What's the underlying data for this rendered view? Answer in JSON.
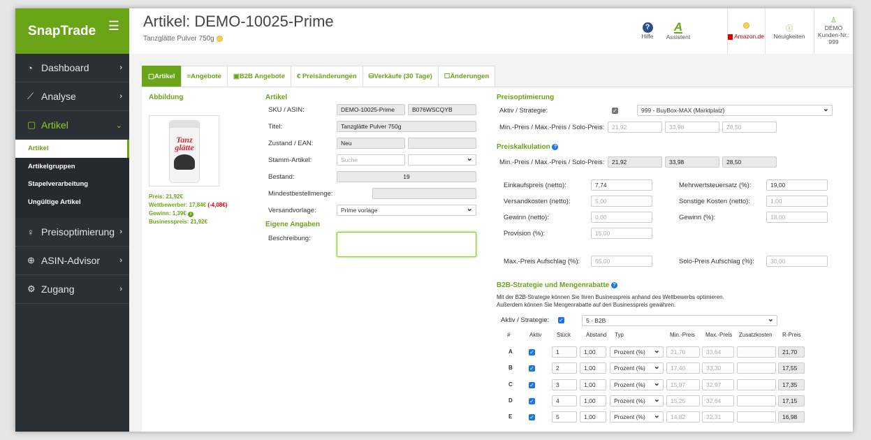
{
  "app": {
    "logo": "SnapTrade"
  },
  "sidebar": {
    "items": [
      {
        "label": "Dashboard",
        "icon": "dashboard-gauge-icon"
      },
      {
        "label": "Analyse",
        "icon": "chart-line-icon"
      },
      {
        "label": "Artikel",
        "icon": "bag-icon"
      },
      {
        "label": "Preisoptimierung",
        "icon": "lightbulb-icon"
      },
      {
        "label": "ASIN-Advisor",
        "icon": "magnifier-plus-icon"
      },
      {
        "label": "Zugang",
        "icon": "gear-icon"
      }
    ],
    "subitems": [
      "Artikel",
      "Artikelgruppen",
      "Stapelverarbeitung",
      "Ungültige Artikel"
    ]
  },
  "header": {
    "title": "Artikel: DEMO-10025-Prime",
    "subtitle": "Tanzglätte Pulver 750g",
    "help": "Hilfe",
    "assistant": "Assistent",
    "amazon": "Amazon.de",
    "news": "Neuigkeiten",
    "user": "DEMO",
    "customer": "Kunden-Nr.: 999"
  },
  "tabs": [
    "Artikel",
    "Angebote",
    "B2B Angebote",
    "€ Preisänderungen",
    "Verkäufe (30 Tage)",
    "Änderungen"
  ],
  "left": {
    "heading": "Abbildung",
    "metrics": [
      {
        "label": "Preis: 21,92€",
        "color": "#6aa517"
      },
      {
        "label": "Wettbewerber: 17,84€",
        "extra": "(-4,08€)",
        "color": "#6aa517"
      },
      {
        "label": "Gewinn: 1,39€",
        "color": "#6aa517"
      },
      {
        "label": "Businesspreis: 21,92€",
        "color": "#6aa517"
      }
    ],
    "product_label": "Tanz glätte"
  },
  "artikel": {
    "heading": "Artikel",
    "sku_label": "SKU / ASIN:",
    "sku": "DEMO-10025-Prime",
    "asin": "B076WSCQYB",
    "title_label": "Titel:",
    "title": "Tanzglätte Pulver 750g",
    "cond_label": "Zustand / EAN:",
    "cond": "Neu",
    "ean": "",
    "stamm_label": "Stamm-Artikel:",
    "stamm_placeholder": "Suche",
    "bestand_label": "Bestand:",
    "bestand": "19",
    "mindest_label": "Mindestbestellmenge:",
    "mindest": "",
    "versand_label": "Versandvorlage:",
    "versand": "Prime vorlage",
    "eigene_heading": "Eigene Angaben",
    "desc_label": "Beschreibung:"
  },
  "preisopt": {
    "heading": "Preisoptimierung",
    "aktiv_label": "Aktiv / Strategie:",
    "strategy": "999 - BuyBox-MAX (Marktplatz)",
    "minmax_label": "Min.-Preis / Max.-Preis / Solo-Preis:",
    "min": "21,92",
    "max": "33,98",
    "solo": "28,50"
  },
  "kalkulation": {
    "heading": "Preiskalkulation",
    "minmax_label": "Min.-Preis / Max.-Preis / Solo-Preis:",
    "min": "21,92",
    "max": "33,98",
    "solo": "28,50",
    "ek_label": "Einkaufspreis (netto):",
    "ek": "7,74",
    "mwst_label": "Mehrwertsteuersatz (%):",
    "mwst": "19,00",
    "vk_label": "Versandkosten (netto):",
    "vk": "5,00",
    "sk_label": "Sonstige Kosten (netto):",
    "sk": "1,00",
    "gewinn_label": "Gewinn (netto):",
    "gewinn": "0,00",
    "gewinnp_label": "Gewinn (%):",
    "gewinnp": "18,00",
    "prov_label": "Provision (%):",
    "prov": "15,00",
    "maxauf_label": "Max.-Preis Aufschlag (%):",
    "maxauf": "55,00",
    "soloauf_label": "Solo-Preis Aufschlag (%):",
    "soloauf": "30,00"
  },
  "b2b": {
    "heading": "B2B-Strategie und Mengenrabatte",
    "desc1": "Mit der B2B-Strategie können Sie Ihren Businesspreis anhand des Wettbewerbs optimieren.",
    "desc2": "Außerdem können Sie Mengenrabatte auf den Businesspreis gewähren.",
    "aktiv_label": "Aktiv / Strategie:",
    "strategy": "5 - B2B",
    "headers": [
      "#",
      "Aktiv",
      "Stück",
      "Abstand",
      "Typ",
      "Min.-Preis",
      "Max.-Preis",
      "Zusatzkosten",
      "R-Preis"
    ],
    "rows": [
      {
        "id": "A",
        "stueck": "1",
        "abstand": "1,00",
        "typ": "Prozent (%)",
        "min": "21,70",
        "max": "33,64",
        "zusatz": "",
        "r": "21,70"
      },
      {
        "id": "B",
        "stueck": "2",
        "abstand": "1,00",
        "typ": "Prozent (%)",
        "min": "17,40",
        "max": "33,30",
        "zusatz": "",
        "r": "17,55"
      },
      {
        "id": "C",
        "stueck": "3",
        "abstand": "1,00",
        "typ": "Prozent (%)",
        "min": "15,97",
        "max": "32,97",
        "zusatz": "",
        "r": "17,35"
      },
      {
        "id": "D",
        "stueck": "4",
        "abstand": "1,00",
        "typ": "Prozent (%)",
        "min": "15,25",
        "max": "32,64",
        "zusatz": "",
        "r": "17,15"
      },
      {
        "id": "E",
        "stueck": "5",
        "abstand": "1,00",
        "typ": "Prozent (%)",
        "min": "14,82",
        "max": "32,31",
        "zusatz": "",
        "r": "16,98"
      }
    ]
  },
  "colors": {
    "brand": "#6aa517",
    "sidebar": "#2b3034",
    "checkbox": "#1a73e8"
  }
}
